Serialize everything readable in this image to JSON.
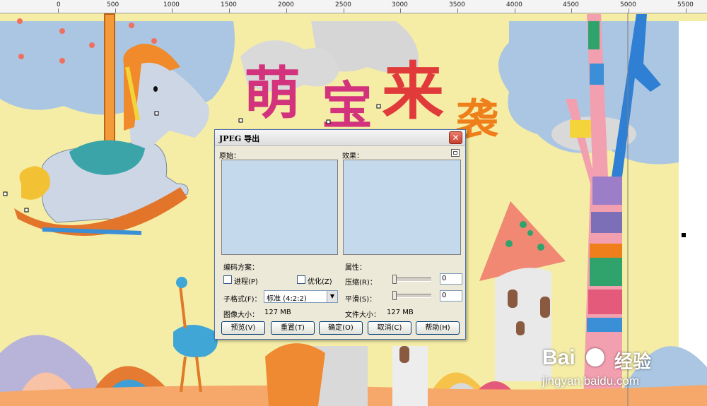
{
  "ruler": {
    "labels": [
      "0",
      "500",
      "1000",
      "1500",
      "2000",
      "2500",
      "3000",
      "3500",
      "4000",
      "4500",
      "5000",
      "5500"
    ]
  },
  "artwork": {
    "title_chars": [
      "萌",
      "宝",
      "来",
      "袭"
    ]
  },
  "dialog": {
    "title": "JPEG 导出",
    "close_symbol": "✕",
    "original_label": "原始：",
    "result_label": "效果：",
    "encoding_label": "编码方案：",
    "progressive_label": "进程(P)",
    "optimize_label": "优化(Z)",
    "subformat_label": "子格式(F)：",
    "subformat_value": "标准 (4:2:2)",
    "image_size_label": "图像大小：",
    "image_size_value": "127 MB",
    "properties_label": "属性：",
    "compression_label": "压缩(R)：",
    "compression_value": "0",
    "smoothing_label": "平滑(S)：",
    "smoothing_value": "0",
    "file_size_label": "文件大小：",
    "file_size_value": "127 MB",
    "buttons": {
      "preview": "预览(V)",
      "reset": "重置(T)",
      "ok": "确定(O)",
      "cancel": "取消(C)",
      "help": "帮助(H)"
    }
  },
  "watermark": {
    "brand_left": "Bai",
    "brand_right": "经验",
    "url": "jingyan.baidu.com"
  },
  "colors": {
    "sky": "#aac6e2",
    "background": "#f5eda6",
    "title_magenta": "#d2337c",
    "title_red": "#e03a3a",
    "title_orange": "#ef7f1a",
    "preview_blue": "#c5d9ec"
  }
}
